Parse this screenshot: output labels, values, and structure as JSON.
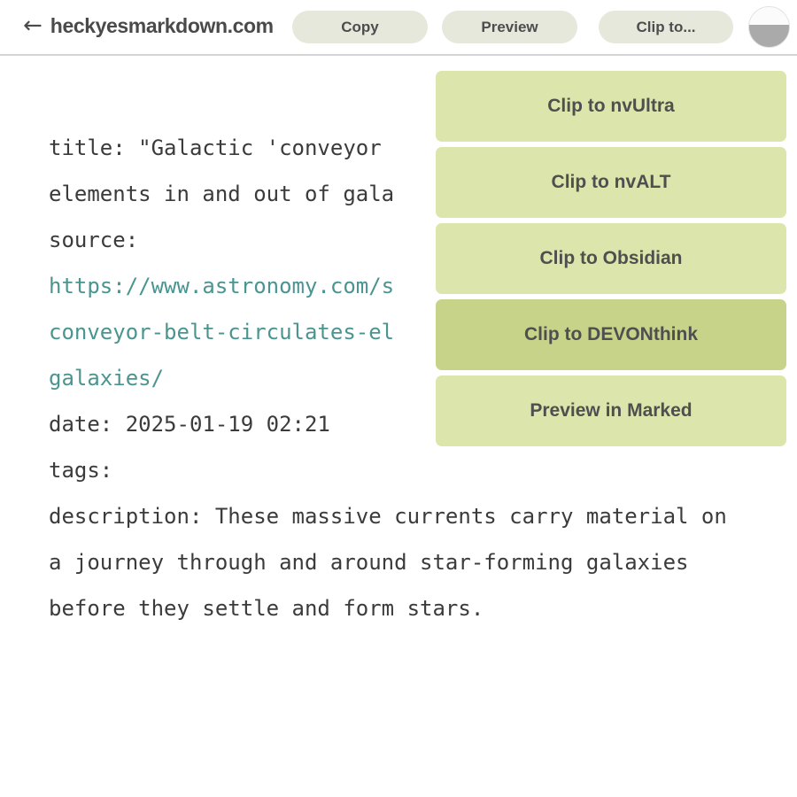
{
  "header": {
    "back_arrow": "←",
    "site_name": "heckyesmarkdown.com",
    "buttons": [
      {
        "label": "Copy",
        "name": "copy-button"
      },
      {
        "label": "Preview",
        "name": "preview-button"
      },
      {
        "label": "Clip to...",
        "name": "clipto-button"
      }
    ],
    "avatar_icon": "user-avatar-icon",
    "button_bg": "#e6e8dc",
    "text_color": "#4a4a4a"
  },
  "document": {
    "lines": [
      {
        "text": "title: \"Galactic 'conveyor",
        "type": "plain"
      },
      {
        "text": "elements in and out of gala",
        "type": "plain"
      },
      {
        "text": "source:",
        "type": "plain"
      },
      {
        "text": "https://www.astronomy.com/s",
        "type": "link"
      },
      {
        "text": "conveyor-belt-circulates-el",
        "type": "link"
      },
      {
        "text": "galaxies/",
        "type": "link"
      },
      {
        "text": "date: 2025-01-19 02:21",
        "type": "plain"
      },
      {
        "text": "tags:",
        "type": "plain"
      }
    ],
    "description": "description: These massive currents carry material on a journey through and around star-forming galaxies before they settle and form stars.",
    "link_color": "#4a9590",
    "text_color": "#3b3b3b"
  },
  "clip_menu": {
    "items": [
      {
        "label": "Clip to nvUltra",
        "active": false,
        "name": "menu-item-clip-to-nvultra"
      },
      {
        "label": "Clip to nvALT",
        "active": false,
        "name": "menu-item-clip-to-nvalt"
      },
      {
        "label": "Clip to Obsidian",
        "active": false,
        "name": "menu-item-clip-to-obsidian"
      },
      {
        "label": "Clip to DEVONthink",
        "active": true,
        "name": "menu-item-clip-to-devonthink"
      },
      {
        "label": "Preview in Marked",
        "active": false,
        "name": "menu-item-preview-in-marked"
      }
    ],
    "item_bg": "#dce5ab",
    "item_bg_active": "#c6d389",
    "item_text_color": "#4f4f4f"
  }
}
